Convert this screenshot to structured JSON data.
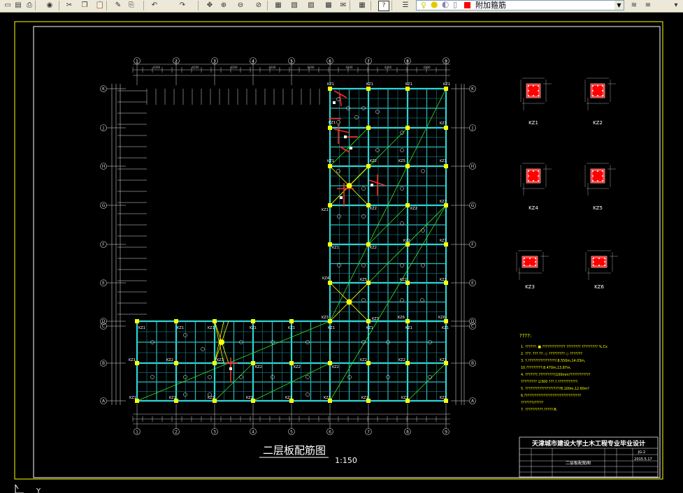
{
  "toolbar": {
    "layer_name": "附加箍筋",
    "buttons": [
      "open-icon",
      "save-icon",
      "plot-icon",
      "publish-icon",
      "cut-icon",
      "copy-icon",
      "paste-icon",
      "brush-icon",
      "match-icon",
      "undo-icon",
      "redo-icon",
      "pan-icon",
      "zoom-window-icon",
      "zoom-realtime-icon",
      "zoom-previous-icon",
      "properties-icon",
      "design-center-icon",
      "tool-palette-icon",
      "sheet-set-icon",
      "markup-icon",
      "calculator-icon",
      "help-icon",
      "layer-manager-icon",
      "bulb-icon",
      "sun-icon",
      "lock-icon",
      "color-icon",
      "layer-prev-icon",
      "layer-states-icon"
    ],
    "colors": {
      "layer_color": "#ff0000",
      "bulb": "#ffff00"
    }
  },
  "drawing": {
    "title": "二层板配筋图",
    "scale": "1:150",
    "grid_columns": [
      "①",
      "②",
      "③",
      "④",
      "⑤",
      "⑥",
      "⑦",
      "⑧",
      "⑨"
    ],
    "grid_rows_left": [
      "Ⓚ",
      "Ⓙ",
      "Ⓗ",
      "Ⓖ",
      "Ⓕ",
      "Ⓔ",
      "Ⓓ",
      "Ⓒ",
      "Ⓑ",
      "Ⓐ"
    ],
    "grid_rows_right": [
      "Ⓚ",
      "Ⓙ",
      "Ⓗ",
      "Ⓖ",
      "Ⓕ",
      "Ⓔ",
      "Ⓓ",
      "Ⓒ",
      "Ⓑ",
      "Ⓐ"
    ],
    "column_labels": [
      "KZ1",
      "KZ2",
      "KZ3",
      "KZ4",
      "KZ5",
      "KZ6"
    ],
    "sections": [
      "KZ1",
      "KZ2",
      "KZ4",
      "KZ5",
      "KZ3",
      "KZ6"
    ],
    "notes_heading": "????:",
    "notes": [
      "1. ??????:  ■ ?????????????  ????????     ?????????    %.Cx",
      "2. ???:  ???  ??: ○ ????????? ○ ???????",
      "3. ?.????????????????:8.550m,14.03m,",
      "   10.?????????:8.470m,13.87m.",
      "4. ???????.?????????(100mm????????????",
      "   ????????? 1/300 ???.?.???????????.",
      "5. ????????????????????8.100m,12.60m?",
      "6.????????????????????????????????",
      "   ???????/?????",
      "7. ??????????.?????-B."
    ],
    "title_block": {
      "school": "天津城市建设大学土木工程专业毕业设计",
      "drawing_name": "二层板配筋图",
      "sheet": "JG-2",
      "date": "2015.5.17"
    }
  },
  "statusbar": {
    "axis": "Y"
  }
}
